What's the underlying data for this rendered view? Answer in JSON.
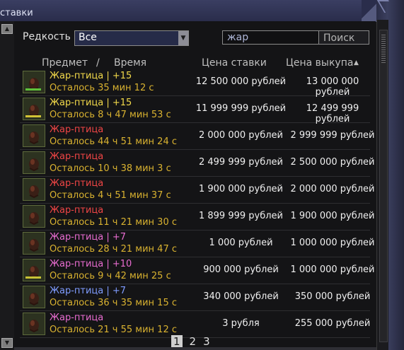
{
  "window": {
    "title_fragment": "ставки"
  },
  "filters": {
    "rarity_label": "Редкость",
    "rarity_value": "Все",
    "search_value": "жар",
    "search_button": "Поиск"
  },
  "table_header": {
    "item": "Предмет",
    "sep": "/",
    "time": "Время",
    "bid_price": "Цена ставки",
    "buyout_price": "Цена выкупа",
    "sort_indicator": "▲"
  },
  "rows": [
    {
      "name": "Жар-птица | +15",
      "time": "Осталось 35 мин 12 с",
      "bid": "12 500 000 рублей",
      "buyout": "13 000 000 рублей",
      "name_color": "#f2d94a",
      "bar_color": "#5fc23b"
    },
    {
      "name": "Жар-птица | +15",
      "time": "Осталось 8 ч 47 мин 53 с",
      "bid": "11 999 999 рублей",
      "buyout": "12 499 999 рублей",
      "name_color": "#f2d94a",
      "bar_color": "#d2c235"
    },
    {
      "name": "Жар-птица",
      "time": "Осталось 44 ч 51 мин 24 с",
      "bid": "2 000 000 рублей",
      "buyout": "2 999 999 рублей",
      "name_color": "#ef4545",
      "bar_color": ""
    },
    {
      "name": "Жар-птица",
      "time": "Осталось 10 ч 38 мин 3 с",
      "bid": "2 499 999 рублей",
      "buyout": "2 500 000 рублей",
      "name_color": "#ef4545",
      "bar_color": ""
    },
    {
      "name": "Жар-птица",
      "time": "Осталось 4 ч 51 мин 37 с",
      "bid": "1 900 000 рублей",
      "buyout": "2 000 000 рублей",
      "name_color": "#ef4545",
      "bar_color": ""
    },
    {
      "name": "Жар-птица",
      "time": "Осталось 11 ч 21 мин 30 с",
      "bid": "1 899 999 рублей",
      "buyout": "1 900 000 рублей",
      "name_color": "#ef4545",
      "bar_color": ""
    },
    {
      "name": "Жар-птица | +7",
      "time": "Осталось 28 ч 21 мин 47 с",
      "bid": "1 000 рублей",
      "buyout": "1 000 000 рублей",
      "name_color": "#e86cd0",
      "bar_color": ""
    },
    {
      "name": "Жар-птица | +10",
      "time": "Осталось 9 ч 42 мин 25 с",
      "bid": "900 000 рублей",
      "buyout": "1 000 000 рублей",
      "name_color": "#e86cd0",
      "bar_color": "#c8c235"
    },
    {
      "name": "Жар-птица | +7",
      "time": "Осталось 36 ч 35 мин 15 с",
      "bid": "340 000 рублей",
      "buyout": "350 000 рублей",
      "name_color": "#7f9cff",
      "bar_color": ""
    },
    {
      "name": "Жар-птица",
      "time": "Осталось 21 ч 55 мин 12 с",
      "bid": "3 рубля",
      "buyout": "255 000 рублей",
      "name_color": "#e86cd0",
      "bar_color": ""
    }
  ],
  "pagination": {
    "pages": [
      "1",
      "2",
      "3"
    ],
    "current": "1"
  }
}
